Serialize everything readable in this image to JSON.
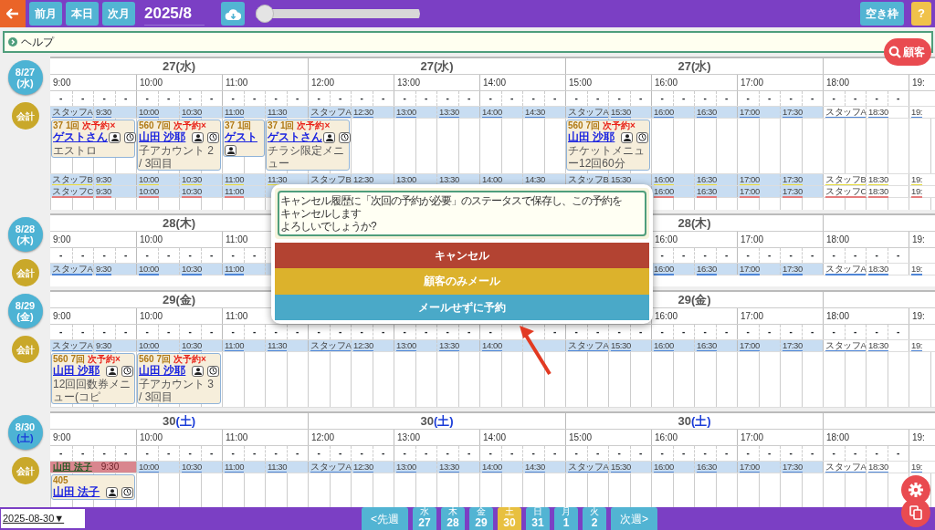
{
  "top_bar": {
    "nav_buttons": [
      "前月",
      "本日",
      "次月"
    ],
    "title": "2025/8",
    "slider": {
      "level": 0
    },
    "vacancy_button": "空き枠",
    "help_button": "?"
  },
  "help_bar": {
    "label": "ヘルプ",
    "expanded": false
  },
  "customer_button": "顧客",
  "days": [
    {
      "date": "8/27",
      "weekday": "(水)",
      "kind": "weekday",
      "checkout": "会計",
      "headers": [
        [
          {
            "day": "27",
            "weekday": "(水)"
          },
          {
            "day": "27",
            "weekday": "(水)"
          },
          {
            "day": "27",
            "weekday": "(水)"
          }
        ]
      ],
      "hours": [
        [
          "9:00",
          "10:00",
          "11:00",
          "12:00",
          "13:00",
          "14:00",
          "15:00",
          "16:00",
          "17:00",
          "18:00",
          "19:"
        ]
      ],
      "slots": [
        [
          "-",
          "-",
          "-",
          "-",
          "-",
          "-",
          "-",
          "-",
          "-",
          "-",
          "-",
          "-",
          "-",
          "-",
          "-",
          "-",
          "-",
          "-",
          "-",
          "-",
          "-",
          "-",
          "-",
          "-",
          "-",
          "-",
          "-",
          "-",
          "-",
          "-",
          "-",
          "-",
          "-",
          "-",
          "-",
          "-",
          "-",
          "-",
          "-",
          "-"
        ]
      ],
      "staff": [
        {
          "color": "#4f86d6",
          "labels": [
            [
              {
                "text": "スタッフA",
                "appointment": {
                  "kind": "standard",
                  "count": "37 1回",
                  "status": "次予約×",
                  "name": "ゲストさん",
                  "menu": "エストロ"
                }
              },
              "9:30",
              {
                "text": "10:00",
                "appointment": {
                  "kind": "standard",
                  "count": "560 7回",
                  "status": "次予約×",
                  "name": "山田 沙耶",
                  "menu": "子アカウント 2 / 3回目"
                }
              },
              "10:30",
              {
                "text": "11:00",
                "appointment": {
                  "kind": "narrow",
                  "count": "37 1回",
                  "name": "ゲスト"
                }
              },
              {
                "text": "11:30",
                "appointment": {
                  "kind": "standard",
                  "count": "37 1回",
                  "status": "次予約×",
                  "name": "ゲストさん",
                  "menu": "チラシ限定メニュー"
                }
              },
              "スタッフA",
              "12:30",
              "13:00",
              "13:30",
              "14:00",
              "14:30",
              {
                "text": "スタッフA",
                "appointment": {
                  "kind": "standard",
                  "count": "560 7回",
                  "status": "次予約×",
                  "name": "山田 沙耶",
                  "menu": "チケットメニュー12回60分"
                }
              },
              "15:30",
              "16:00",
              "16:30",
              "17:00",
              "17:30",
              "スタッフA",
              "18:30",
              "19:"
            ]
          ]
        },
        {
          "color": "#e6dc3c",
          "labels": [
            [
              "スタッフB",
              "9:30",
              "10:00",
              "10:30",
              "11:00",
              "11:30",
              "スタッフB",
              "12:30",
              "13:00",
              "13:30",
              "14:00",
              "14:30",
              "スタッフB",
              "15:30",
              "16:00",
              "16:30",
              "17:00",
              "17:30",
              "スタッフB",
              "18:30",
              "19:"
            ]
          ]
        },
        {
          "color": "#e47c7c",
          "labels": [
            [
              "スタッフC",
              "9:30",
              "10:00",
              "10:30",
              "11:00"
            ],
            [
              "16:00",
              "16:30",
              "17:00",
              "17:30",
              "スタッフC",
              "18:30",
              "19:"
            ]
          ]
        }
      ]
    },
    {
      "date": "8/28",
      "weekday": "(木)",
      "kind": "weekday",
      "checkout": "会計",
      "headers": [
        [
          {
            "day": "28",
            "weekday": "(木)"
          }
        ],
        [
          {
            "day": "28",
            "weekday": "(木)"
          }
        ]
      ],
      "hours": [
        [
          "9:00",
          "10:00",
          "11:00"
        ],
        [
          "16:00",
          "17:00",
          "18:00",
          "19:"
        ]
      ],
      "slots": [
        [
          "-",
          "-",
          "-",
          "-",
          "-",
          "-",
          "-",
          "-",
          "-",
          "-"
        ],
        [
          "-",
          "-",
          "-",
          "-",
          "-",
          "-",
          "-",
          "-",
          "-",
          "-",
          "-",
          "-"
        ]
      ],
      "staff": [
        {
          "color": "#4f86d6",
          "labels": [
            [
              "スタッフA",
              "9:30",
              "10:00",
              "10:30",
              "11:00"
            ],
            [
              "16:00",
              "16:30",
              "17:00",
              "17:30",
              "スタッフA",
              "18:30",
              "19:"
            ]
          ]
        }
      ]
    },
    {
      "date": "8/29",
      "weekday": "(金)",
      "kind": "weekday",
      "checkout": "会計",
      "headers": [
        [
          {
            "day": "29",
            "weekday": "(金)"
          }
        ],
        [
          {
            "day": "29",
            "weekday": "(金)"
          }
        ]
      ],
      "hours": [
        [
          "9:00",
          "10:00",
          "11:00"
        ],
        [
          "16:00",
          "17:00",
          "18:00",
          "19:"
        ]
      ],
      "slots": [
        [
          "-",
          "-",
          "-",
          "-",
          "-",
          "-",
          "-",
          "-",
          "-",
          "-",
          "-",
          "-",
          "-",
          "-",
          "-",
          "-",
          "-",
          "-",
          "-",
          "-",
          "-"
        ],
        [
          "-",
          "-",
          "-",
          "-",
          "-",
          "-",
          "-",
          "-",
          "-",
          "-",
          "-",
          "-",
          "-",
          "-",
          "-",
          "-",
          "-"
        ]
      ],
      "staff": [
        {
          "color": "#4f86d6",
          "labels": [
            [
              {
                "text": "スタッフA",
                "appointment": {
                  "kind": "standard",
                  "count": "560 7回",
                  "status": "次予約×",
                  "name": "山田 沙耶",
                  "menu": "12回回数券メニュー(コピ"
                }
              },
              "9:30",
              {
                "text": "10:00",
                "appointment": {
                  "kind": "standard",
                  "count": "560 7回",
                  "status": "次予約×",
                  "name": "山田 沙耶",
                  "menu": "子アカウント 3 / 3回目"
                }
              },
              "10:30",
              "11:00",
              "11:30",
              "スタッフA",
              "12:30",
              "13:00",
              "13:30",
              "14:00"
            ],
            [
              "スタッフA",
              "15:30",
              "16:00",
              "16:30",
              "17:00",
              "17:30",
              "スタッフA",
              "18:30",
              "19:"
            ]
          ]
        }
      ]
    },
    {
      "date": "8/30",
      "weekday": "(土)",
      "kind": "saturday",
      "checkout": "会計",
      "headers": [
        [
          {
            "day": "30",
            "weekday": "(土)"
          },
          {
            "day": "30",
            "weekday": "(土)"
          },
          {
            "day": "30",
            "weekday": "(土)"
          }
        ]
      ],
      "hours": [
        [
          "9:00",
          "10:00",
          "11:00",
          "12:00",
          "13:00",
          "14:00",
          "15:00",
          "16:00",
          "17:00",
          "18:00",
          "19:"
        ]
      ],
      "slots": [
        [
          "-",
          "-",
          "-",
          "-",
          "-",
          "-",
          "-",
          "-",
          "-",
          "-",
          "-",
          "-",
          "-",
          "-",
          "-",
          "-",
          "-",
          "-",
          "-",
          "-",
          "-",
          "-",
          "-",
          "-",
          "-",
          "-",
          "-",
          "-",
          "-",
          "-",
          "-",
          "-",
          "-",
          "-",
          "-",
          "-",
          "-",
          "-",
          "-",
          "-"
        ]
      ],
      "staff": [
        {
          "color": "#4f86d6",
          "hold": {
            "name": "山田 法子",
            "time": "9:30",
            "appointment": {
              "kind": "standard",
              "count": "405",
              "name": "山田 法子"
            }
          },
          "labels": [
            [
              "10:00",
              "10:30",
              "11:00",
              "11:30",
              "スタッフA",
              "12:30",
              "13:00",
              "13:30",
              "14:00",
              "14:30",
              "スタッフA",
              "15:30",
              "16:00",
              "16:30",
              "17:00",
              "17:30",
              "スタッフA",
              "18:30",
              "19:"
            ]
          ]
        }
      ]
    }
  ],
  "dialog": {
    "message_lines": [
      "キャンセル履歴に「次回の予約が必要」のステータスで保存し、この予約を",
      "キャンセルします",
      "よろしいでしょうか?"
    ],
    "buttons": [
      {
        "label": "キャンセル",
        "kind": "danger"
      },
      {
        "label": "顧客のみメール",
        "kind": "warning"
      },
      {
        "label": "メールせずに予約",
        "kind": "info"
      }
    ]
  },
  "bottom_bar": {
    "date_select": "2025-08-30▼",
    "prev_week": "<先週",
    "next_week": "次週>",
    "days": [
      {
        "weekday": "水",
        "day": "27",
        "selected": false
      },
      {
        "weekday": "木",
        "day": "28",
        "selected": false
      },
      {
        "weekday": "金",
        "day": "29",
        "selected": false
      },
      {
        "weekday": "土",
        "day": "30",
        "selected": true
      },
      {
        "weekday": "日",
        "day": "31",
        "selected": false
      },
      {
        "weekday": "月",
        "day": "1",
        "selected": false
      },
      {
        "weekday": "火",
        "day": "2",
        "selected": false
      }
    ]
  }
}
